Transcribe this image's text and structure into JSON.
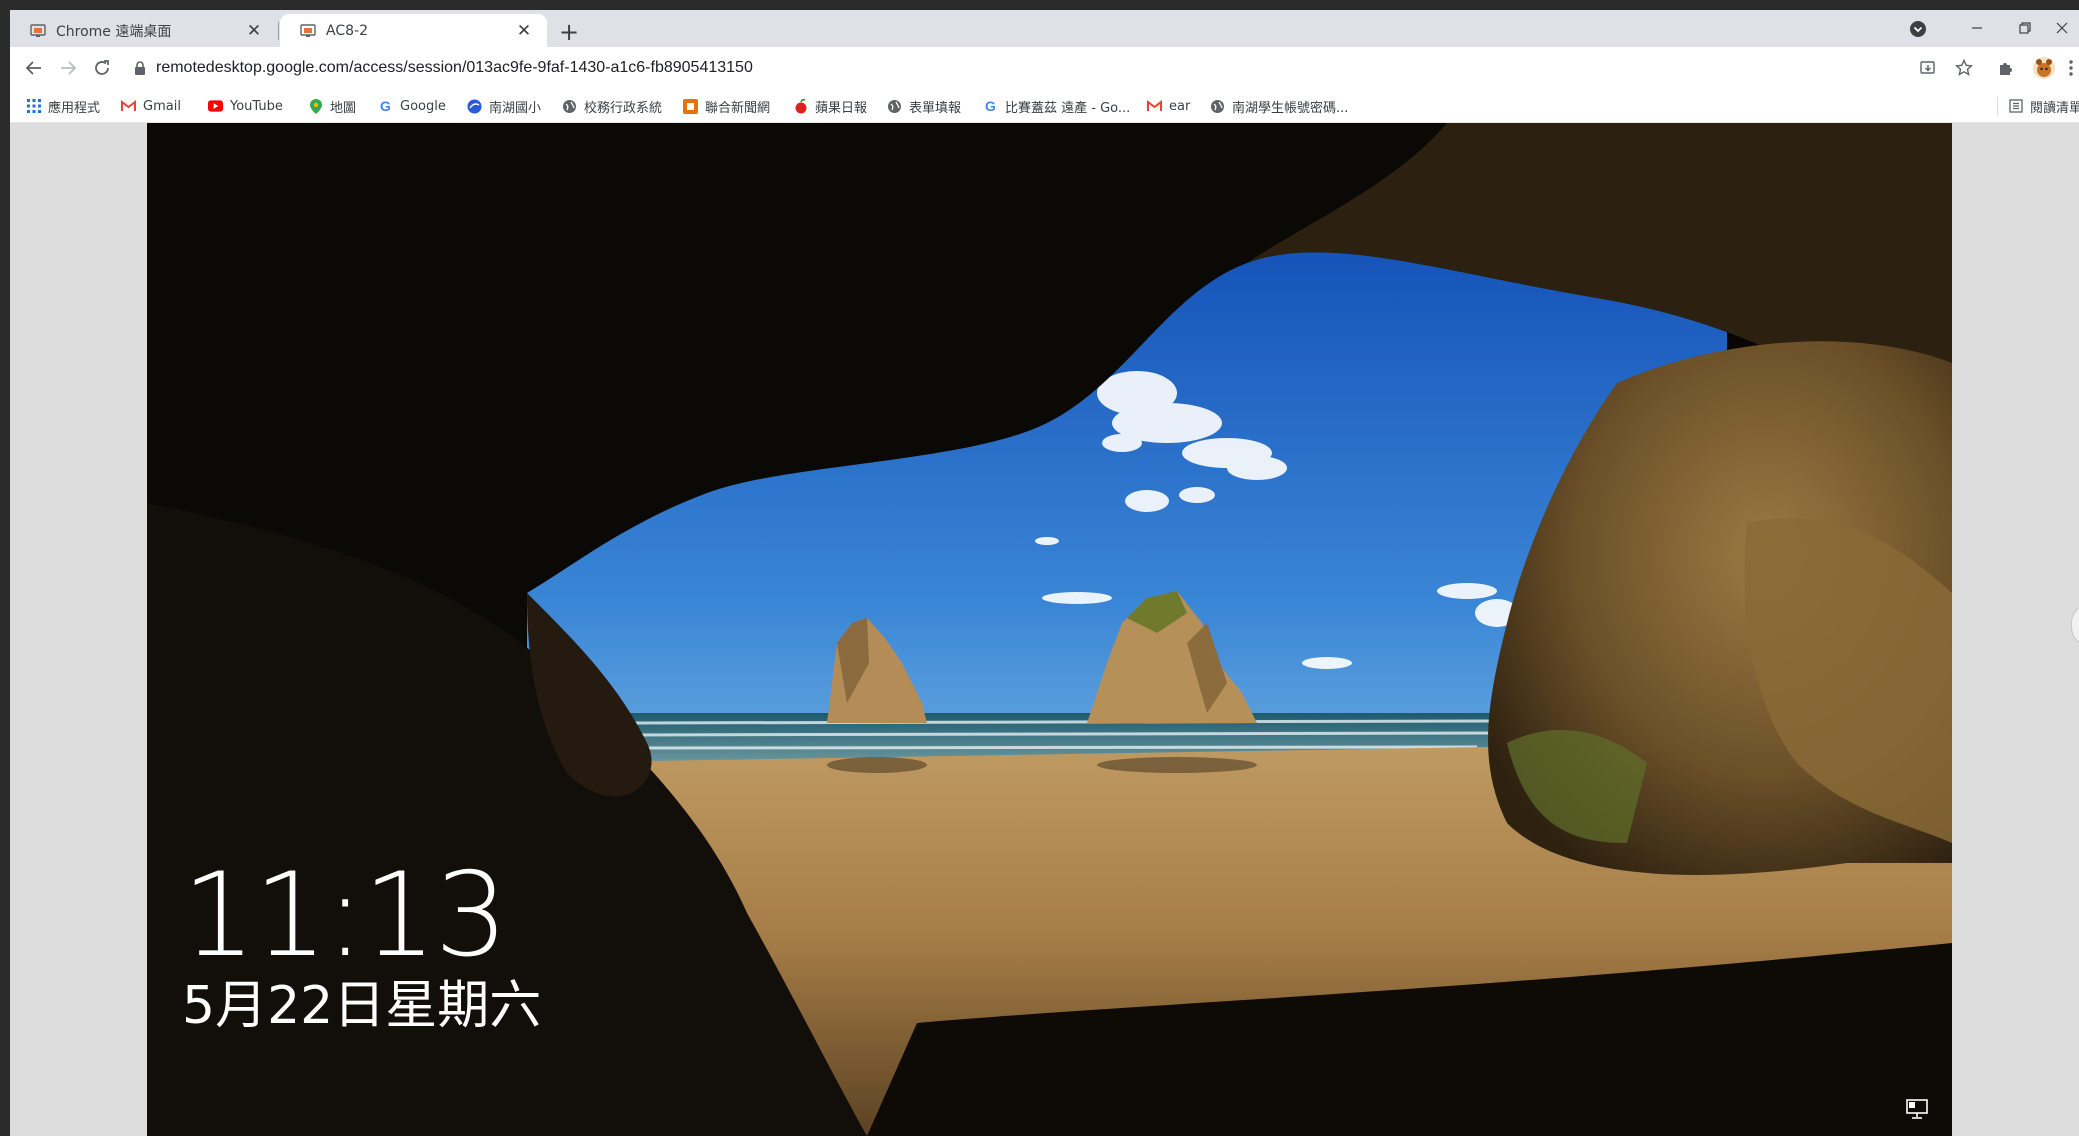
{
  "tabs": [
    {
      "title": "Chrome 遠端桌面",
      "active": false
    },
    {
      "title": "AC8-2",
      "active": true
    }
  ],
  "toolbar": {
    "url": "remotedesktop.google.com/access/session/013ac9fe-9faf-1430-a1c6-fb8905413150"
  },
  "bookmarks": {
    "apps_label": "應用程式",
    "items": [
      {
        "label": "Gmail",
        "icon": "gmail-icon"
      },
      {
        "label": "YouTube",
        "icon": "youtube-icon"
      },
      {
        "label": "地圖",
        "icon": "maps-pin-icon"
      },
      {
        "label": "Google",
        "icon": "google-g-icon"
      },
      {
        "label": "南湖國小",
        "icon": "school-logo-icon"
      },
      {
        "label": "校務行政系統",
        "icon": "globe-icon"
      },
      {
        "label": "聯合新聞網",
        "icon": "udn-icon"
      },
      {
        "label": "蘋果日報",
        "icon": "apple-daily-icon"
      },
      {
        "label": "表單填報",
        "icon": "globe-icon"
      },
      {
        "label": "比賽蓋茲 遠產 - Go...",
        "icon": "google-g-icon"
      },
      {
        "label": "ear",
        "icon": "gmail-icon"
      },
      {
        "label": "南湖學生帳號密碼...",
        "icon": "globe-icon"
      }
    ],
    "reading_list_label": "閱讀清單"
  },
  "lock_screen": {
    "time": "11:13",
    "date": "5月22日星期六"
  },
  "colors": {
    "tabstrip": "#dee1e6",
    "sky": "#1f63b8",
    "sand": "#b08550",
    "rock": "#6b5230"
  }
}
